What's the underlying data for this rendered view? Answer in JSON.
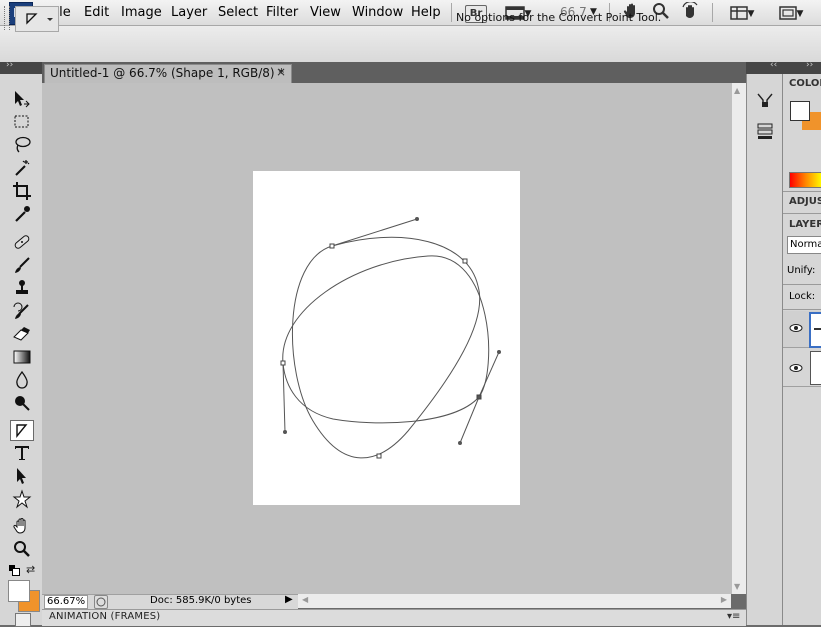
{
  "app": {
    "logo": "Ps"
  },
  "menu": [
    "File",
    "Edit",
    "Image",
    "Layer",
    "Select",
    "Filter",
    "View",
    "Window",
    "Help"
  ],
  "toolbar": {
    "bridge_label": "Br",
    "zoom": "66.7"
  },
  "options_bar": {
    "message": "No options for the Convert Point Tool."
  },
  "document": {
    "tab_title": "Untitled-1 @ 66.7% (Shape 1, RGB/8) *",
    "close_glyph": "×"
  },
  "status_bar": {
    "zoom": "66.67%",
    "doc_info": "Doc: 585.9K/0 bytes"
  },
  "animation_panel": {
    "label": "ANIMATION (FRAMES)"
  },
  "panels": {
    "color_label": "COLOR",
    "adjustments_label": "ADJUS",
    "layers_label": "LAYER",
    "blend_mode": "Norma",
    "unify_label": "Unify:",
    "lock_label": "Lock:"
  },
  "colors": {
    "foreground": "#ffffff",
    "background": "#f0932b",
    "canvas": "#c0c0c0",
    "accent": "#3a6fc4"
  }
}
